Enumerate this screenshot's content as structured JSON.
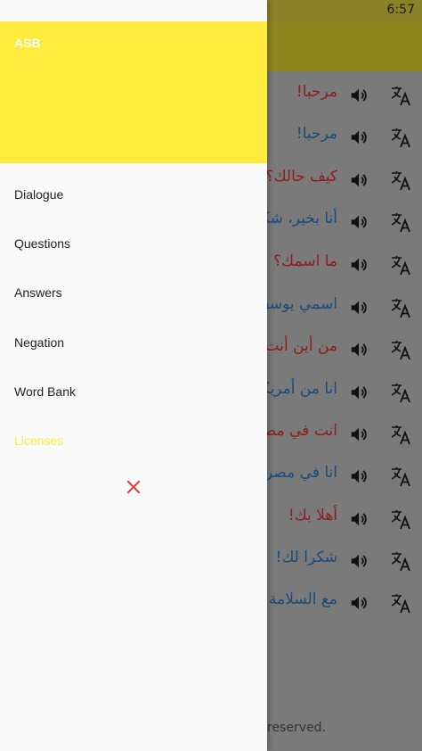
{
  "status_bar": {
    "time": "6:57"
  },
  "drawer": {
    "header_title": "ASB",
    "items": [
      {
        "label": "Dialogue"
      },
      {
        "label": "Questions"
      },
      {
        "label": "Answers"
      },
      {
        "label": "Negation"
      },
      {
        "label": "Word Bank"
      },
      {
        "label": "Licenses"
      }
    ]
  },
  "phrases": [
    {
      "text": "مرحبا!",
      "color": "red"
    },
    {
      "text": "مرحبا!",
      "color": "blue"
    },
    {
      "text": "كيف حالك؟",
      "color": "red"
    },
    {
      "text": "أنا بخير، شكرا",
      "color": "blue"
    },
    {
      "text": "ما اسمك؟",
      "color": "red"
    },
    {
      "text": "اسمي يوسف",
      "color": "blue"
    },
    {
      "text": "من أين أنت؟",
      "color": "red"
    },
    {
      "text": "انا من أمريكا",
      "color": "blue"
    },
    {
      "text": "انت في مصر؟",
      "color": "red"
    },
    {
      "text": "انا في مصر",
      "color": "blue"
    },
    {
      "text": "أهلا بك!",
      "color": "red"
    },
    {
      "text": "شكرا لك!",
      "color": "blue"
    },
    {
      "text": "مع السلامة!",
      "color": "blue"
    }
  ],
  "footer": {
    "text": "reserved."
  },
  "colors": {
    "drawer_header": "#ffeb3b",
    "licenses_text": "#ffeb3b",
    "close_icon": "#e53935",
    "phrase_red": "#8f1c1c",
    "phrase_blue": "#1a4a7a"
  }
}
